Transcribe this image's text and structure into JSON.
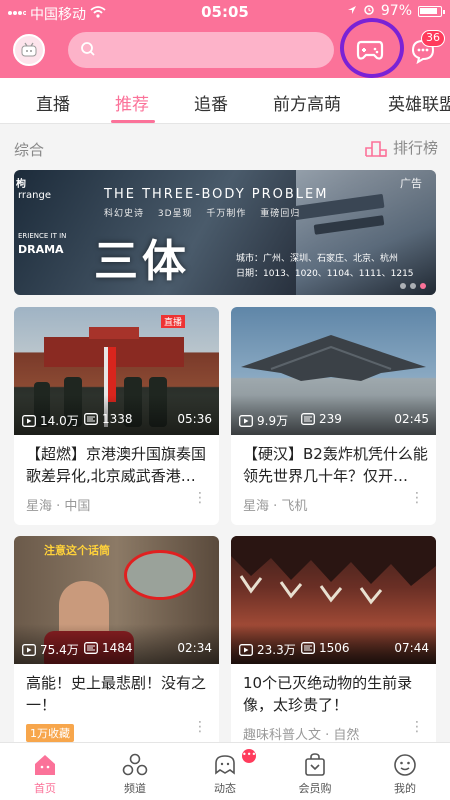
{
  "statusbar": {
    "carrier": "中国移动",
    "time": "05:05",
    "battery": "97%",
    "battery_level": 0.97
  },
  "header": {
    "search_placeholder": "",
    "message_badge": "36"
  },
  "tabs": [
    {
      "label": "直播",
      "active": false
    },
    {
      "label": "推荐",
      "active": true
    },
    {
      "label": "追番",
      "active": false
    },
    {
      "label": "前方高萌",
      "active": false
    },
    {
      "label": "英雄联盟",
      "active": false
    }
  ],
  "section": {
    "title": "综合",
    "ranking_label": "排行榜"
  },
  "banner": {
    "brand": "枸",
    "brand_line2": "rrange",
    "brand_line3": "ERIENCE IT IN",
    "brand_line4": "DRAMA",
    "english_title": "THE THREE-BODY PROBLEM",
    "subtitle": "科幻史诗 3D呈现 千万制作 重磅回归",
    "big_title": "三体",
    "cities": "城市：广州、深圳、石家庄、北京、杭州",
    "dates": "日期：1013、1020、1104、1111、1215",
    "ad_label": "广告"
  },
  "cards": [
    {
      "title": "【超燃】京港澳升国旗奏国歌差异化,北京威武香港…",
      "views": "14.0万",
      "danmaku": "1338",
      "duration": "05:36",
      "source": "星海",
      "tag": "中国",
      "live_label": "直播"
    },
    {
      "title": "【硬汉】B2轰炸机凭什么能领先世界几十年？仅开…",
      "views": "9.9万",
      "danmaku": "239",
      "duration": "02:45",
      "source": "星海",
      "tag": "飞机"
    },
    {
      "title": "高能！史上最悲剧！没有之一！",
      "views": "75.4万",
      "danmaku": "1484",
      "duration": "02:34",
      "badge": "1万收藏",
      "thumb_caption": "注意这个话筒"
    },
    {
      "title": "10个已灭绝动物的生前录像，太珍贵了！",
      "views": "23.3万",
      "danmaku": "1506",
      "duration": "07:44",
      "source": "趣味科普人文",
      "tag": "自然"
    }
  ],
  "bottom_nav": [
    {
      "label": "首页",
      "active": true
    },
    {
      "label": "频道",
      "active": false
    },
    {
      "label": "动态",
      "active": false
    },
    {
      "label": "会员购",
      "active": false
    },
    {
      "label": "我的",
      "active": false
    }
  ],
  "colors": {
    "brand_pink": "#fb7299",
    "annotation_ring": "#7a22d6"
  }
}
